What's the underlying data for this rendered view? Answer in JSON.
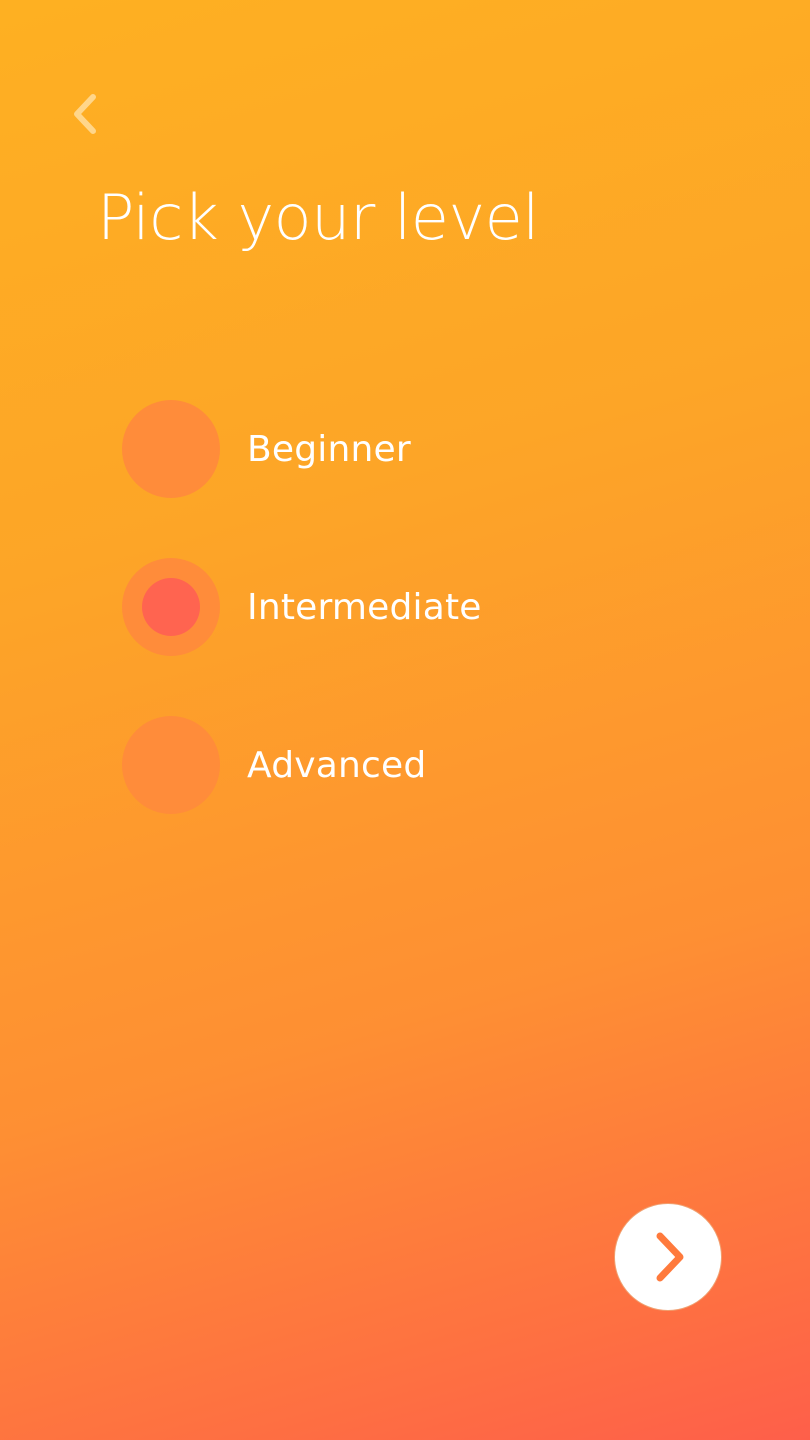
{
  "header": {
    "back_icon": "chevron-left-icon",
    "title": "Pick your level"
  },
  "levels": {
    "selected_index": 1,
    "items": [
      {
        "label": "Beginner",
        "selected": false
      },
      {
        "label": "Intermediate",
        "selected": true
      },
      {
        "label": "Advanced",
        "selected": false
      }
    ]
  },
  "footer": {
    "next_icon": "chevron-right-icon"
  },
  "colors": {
    "gradient_top": "#FEB022",
    "gradient_bottom": "#FE5F4A",
    "radio_ring": "#FF8C3A",
    "radio_selected": "#FF6450",
    "text": "#FFFFFF",
    "next_chevron": "#FF7A3C",
    "back_chevron": "#FFD68A"
  }
}
